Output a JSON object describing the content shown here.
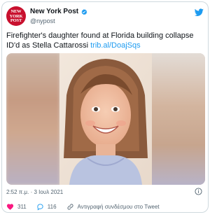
{
  "account": {
    "name": "New York Post",
    "handle": "@nypost",
    "logo_text": [
      "NEW",
      "YORK",
      "POST"
    ]
  },
  "tweet": {
    "text": "Firefighter's daughter found at Florida building collapse ID'd as Stella Cattarossi ",
    "link": "trib.al/DoajSqs",
    "timestamp": "2:52 π.μ. · 3 Ιουλ 2021"
  },
  "actions": {
    "likes": "311",
    "replies": "116",
    "copy_link": "Αντιγραφή συνδέσμου στο Tweet"
  },
  "colors": {
    "accent": "#1d9bf0",
    "like": "#f91880",
    "brand": "#c8102e"
  }
}
